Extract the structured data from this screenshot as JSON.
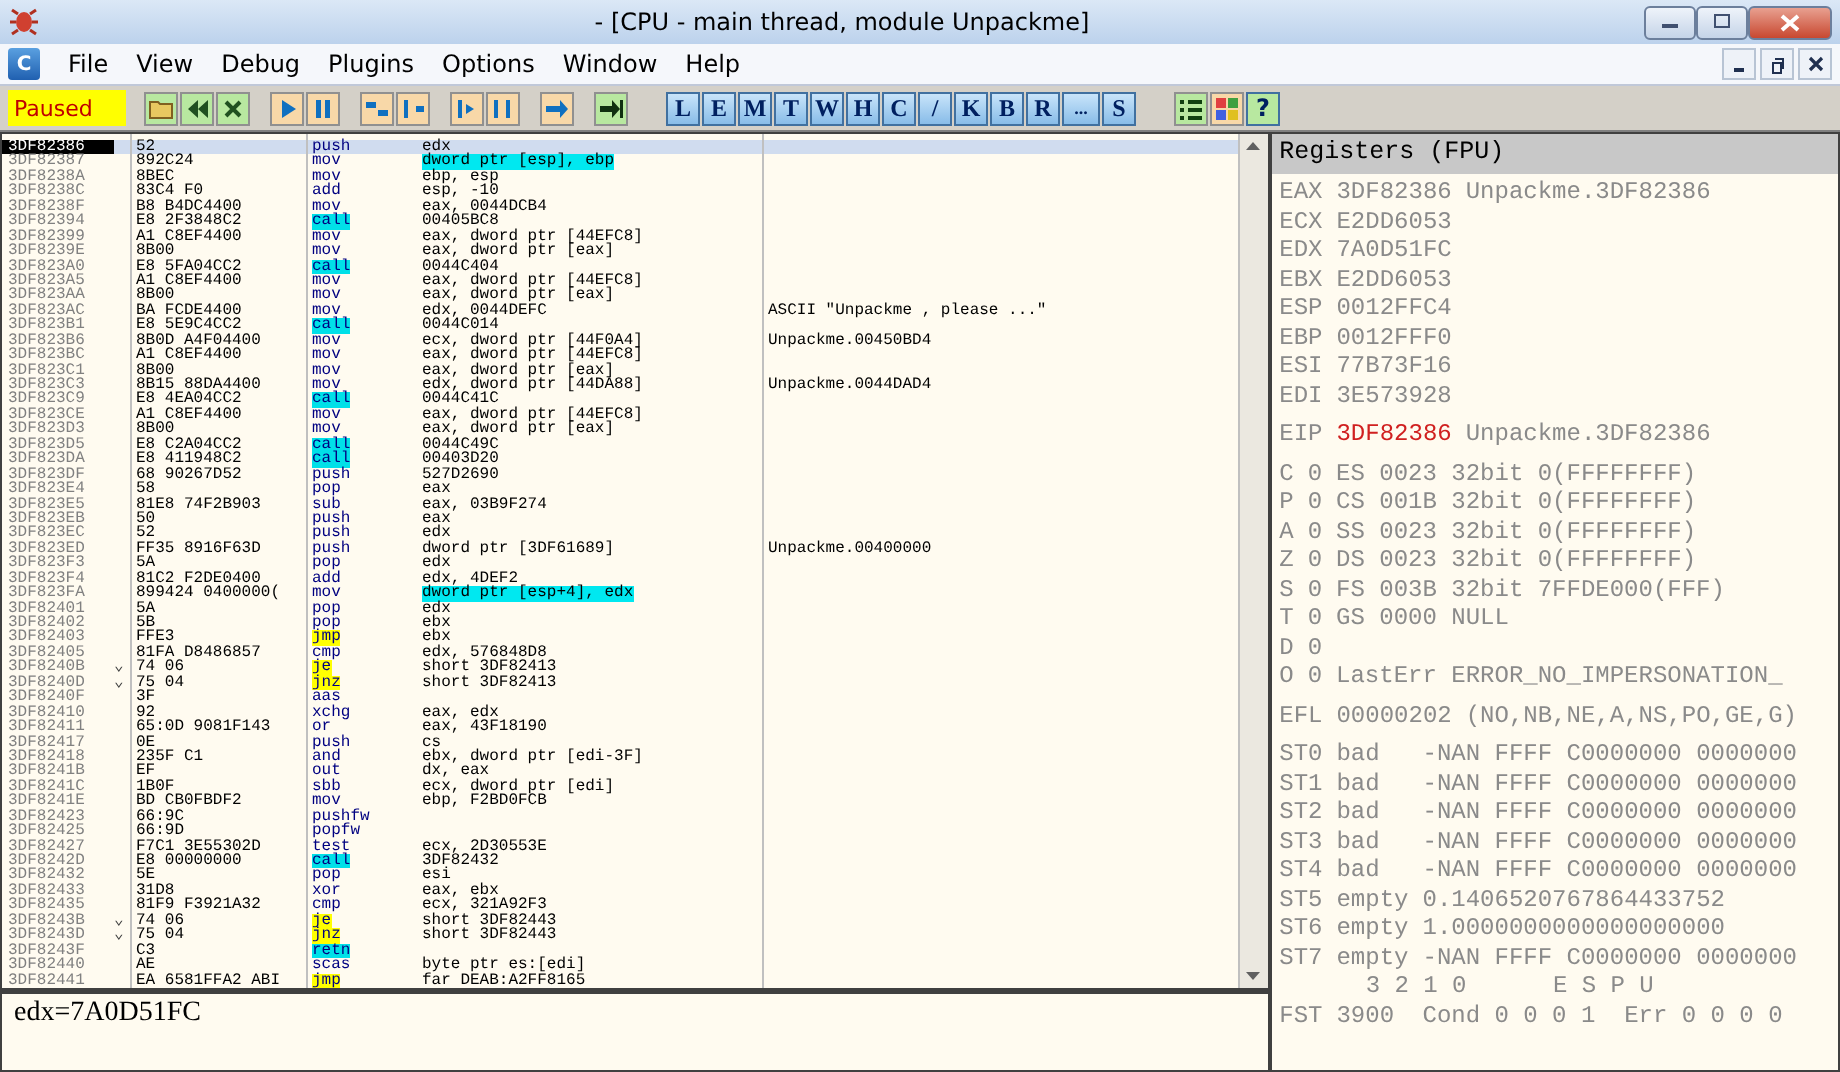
{
  "window": {
    "title": "- [CPU - main thread, module Unpackme]"
  },
  "menu": {
    "child_icon": "C",
    "items": [
      "File",
      "View",
      "Debug",
      "Plugins",
      "Options",
      "Window",
      "Help"
    ]
  },
  "toolbar": {
    "status": "Paused",
    "view_buttons": [
      "L",
      "E",
      "M",
      "T",
      "W",
      "H",
      "C",
      "/",
      "K",
      "B",
      "R",
      "...",
      "S"
    ],
    "help_button": "?"
  },
  "disassembly": {
    "rows": [
      {
        "address": "3DF82386",
        "hex": "52",
        "mnemonic": "push",
        "operand": "edx",
        "kind": "plain",
        "selected": true,
        "operand_marked": false
      },
      {
        "address": "3DF82387",
        "hex": "892C24",
        "mnemonic": "mov",
        "operand": "dword ptr [esp], ebp",
        "kind": "plain",
        "selected": false,
        "operand_marked": true
      },
      {
        "address": "3DF8238A",
        "hex": "8BEC",
        "mnemonic": "mov",
        "operand": "ebp, esp",
        "kind": "plain",
        "selected": false,
        "operand_marked": false
      },
      {
        "address": "3DF8238C",
        "hex": "83C4 F0",
        "mnemonic": "add",
        "operand": "esp, -10",
        "kind": "plain",
        "selected": false,
        "operand_marked": false
      },
      {
        "address": "3DF8238F",
        "hex": "B8 B4DC4400",
        "mnemonic": "mov",
        "operand": "eax, 0044DCB4",
        "kind": "plain",
        "selected": false,
        "operand_marked": false
      },
      {
        "address": "3DF82394",
        "hex": "E8 2F3848C2",
        "mnemonic": "call",
        "operand": "00405BC8",
        "kind": "call",
        "selected": false,
        "operand_marked": false
      },
      {
        "address": "3DF82399",
        "hex": "A1 C8EF4400",
        "mnemonic": "mov",
        "operand": "eax, dword ptr [44EFC8]",
        "kind": "plain",
        "selected": false,
        "operand_marked": false
      },
      {
        "address": "3DF8239E",
        "hex": "8B00",
        "mnemonic": "mov",
        "operand": "eax, dword ptr [eax]",
        "kind": "plain",
        "selected": false,
        "operand_marked": false
      },
      {
        "address": "3DF823A0",
        "hex": "E8 5FA04CC2",
        "mnemonic": "call",
        "operand": "0044C404",
        "kind": "call",
        "selected": false,
        "operand_marked": false
      },
      {
        "address": "3DF823A5",
        "hex": "A1 C8EF4400",
        "mnemonic": "mov",
        "operand": "eax, dword ptr [44EFC8]",
        "kind": "plain",
        "selected": false,
        "operand_marked": false
      },
      {
        "address": "3DF823AA",
        "hex": "8B00",
        "mnemonic": "mov",
        "operand": "eax, dword ptr [eax]",
        "kind": "plain",
        "selected": false,
        "operand_marked": false
      },
      {
        "address": "3DF823AC",
        "hex": "BA FCDE4400",
        "mnemonic": "mov",
        "operand": "edx, 0044DEFC",
        "comment": "ASCII \"Unpackme , please ...\"",
        "kind": "plain",
        "selected": false,
        "operand_marked": false
      },
      {
        "address": "3DF823B1",
        "hex": "E8 5E9C4CC2",
        "mnemonic": "call",
        "operand": "0044C014",
        "kind": "call",
        "selected": false,
        "operand_marked": false
      },
      {
        "address": "3DF823B6",
        "hex": "8B0D A4F04400",
        "mnemonic": "mov",
        "operand": "ecx, dword ptr [44F0A4]",
        "comment": "Unpackme.00450BD4",
        "kind": "plain",
        "selected": false,
        "operand_marked": false
      },
      {
        "address": "3DF823BC",
        "hex": "A1 C8EF4400",
        "mnemonic": "mov",
        "operand": "eax, dword ptr [44EFC8]",
        "kind": "plain",
        "selected": false,
        "operand_marked": false
      },
      {
        "address": "3DF823C1",
        "hex": "8B00",
        "mnemonic": "mov",
        "operand": "eax, dword ptr [eax]",
        "kind": "plain",
        "selected": false,
        "operand_marked": false
      },
      {
        "address": "3DF823C3",
        "hex": "8B15 88DA4400",
        "mnemonic": "mov",
        "operand": "edx, dword ptr [44DA88]",
        "comment": "Unpackme.0044DAD4",
        "kind": "plain",
        "selected": false,
        "operand_marked": false
      },
      {
        "address": "3DF823C9",
        "hex": "E8 4EA04CC2",
        "mnemonic": "call",
        "operand": "0044C41C",
        "kind": "call",
        "selected": false,
        "operand_marked": false
      },
      {
        "address": "3DF823CE",
        "hex": "A1 C8EF4400",
        "mnemonic": "mov",
        "operand": "eax, dword ptr [44EFC8]",
        "kind": "plain",
        "selected": false,
        "operand_marked": false
      },
      {
        "address": "3DF823D3",
        "hex": "8B00",
        "mnemonic": "mov",
        "operand": "eax, dword ptr [eax]",
        "kind": "plain",
        "selected": false,
        "operand_marked": false
      },
      {
        "address": "3DF823D5",
        "hex": "E8 C2A04CC2",
        "mnemonic": "call",
        "operand": "0044C49C",
        "kind": "call",
        "selected": false,
        "operand_marked": false
      },
      {
        "address": "3DF823DA",
        "hex": "E8 411948C2",
        "mnemonic": "call",
        "operand": "00403D20",
        "kind": "call",
        "selected": false,
        "operand_marked": false
      },
      {
        "address": "3DF823DF",
        "hex": "68 90267D52",
        "mnemonic": "push",
        "operand": "527D2690",
        "kind": "plain",
        "selected": false,
        "operand_marked": false
      },
      {
        "address": "3DF823E4",
        "hex": "58",
        "mnemonic": "pop",
        "operand": "eax",
        "kind": "plain",
        "selected": false,
        "operand_marked": false
      },
      {
        "address": "3DF823E5",
        "hex": "81E8 74F2B903",
        "mnemonic": "sub",
        "operand": "eax, 03B9F274",
        "kind": "plain",
        "selected": false,
        "operand_marked": false
      },
      {
        "address": "3DF823EB",
        "hex": "50",
        "mnemonic": "push",
        "operand": "eax",
        "kind": "plain",
        "selected": false,
        "operand_marked": false
      },
      {
        "address": "3DF823EC",
        "hex": "52",
        "mnemonic": "push",
        "operand": "edx",
        "kind": "plain",
        "selected": false,
        "operand_marked": false
      },
      {
        "address": "3DF823ED",
        "hex": "FF35 8916F63D",
        "mnemonic": "push",
        "operand": "dword ptr [3DF61689]",
        "comment": "Unpackme.00400000",
        "kind": "plain",
        "selected": false,
        "operand_marked": false
      },
      {
        "address": "3DF823F3",
        "hex": "5A",
        "mnemonic": "pop",
        "operand": "edx",
        "kind": "plain",
        "selected": false,
        "operand_marked": false
      },
      {
        "address": "3DF823F4",
        "hex": "81C2 F2DE0400",
        "mnemonic": "add",
        "operand": "edx, 4DEF2",
        "kind": "plain",
        "selected": false,
        "operand_marked": false
      },
      {
        "address": "3DF823FA",
        "hex": "899424 0400000(",
        "mnemonic": "mov",
        "operand": "dword ptr [esp+4], edx",
        "kind": "plain",
        "selected": false,
        "operand_marked": true
      },
      {
        "address": "3DF82401",
        "hex": "5A",
        "mnemonic": "pop",
        "operand": "edx",
        "kind": "plain",
        "selected": false,
        "operand_marked": false
      },
      {
        "address": "3DF82402",
        "hex": "5B",
        "mnemonic": "pop",
        "operand": "ebx",
        "kind": "plain",
        "selected": false,
        "operand_marked": false
      },
      {
        "address": "3DF82403",
        "hex": "FFE3",
        "mnemonic": "jmp",
        "operand": "ebx",
        "kind": "jump",
        "selected": false,
        "operand_marked": false
      },
      {
        "address": "3DF82405",
        "hex": "81FA D8486857",
        "mnemonic": "cmp",
        "operand": "edx, 576848D8",
        "kind": "plain",
        "selected": false,
        "operand_marked": false
      },
      {
        "address": "3DF8240B",
        "jump_mark": "⌄",
        "hex": "74 06",
        "mnemonic": "je",
        "operand": "short 3DF82413",
        "kind": "jump",
        "selected": false,
        "operand_marked": false
      },
      {
        "address": "3DF8240D",
        "jump_mark": "⌄",
        "hex": "75 04",
        "mnemonic": "jnz",
        "operand": "short 3DF82413",
        "kind": "jump",
        "selected": false,
        "operand_marked": false
      },
      {
        "address": "3DF8240F",
        "hex": "3F",
        "mnemonic": "aas",
        "kind": "plain",
        "selected": false,
        "operand_marked": false
      },
      {
        "address": "3DF82410",
        "hex": "92",
        "mnemonic": "xchg",
        "operand": "eax, edx",
        "kind": "plain",
        "selected": false,
        "operand_marked": false
      },
      {
        "address": "3DF82411",
        "hex": "65:0D 9081F143",
        "mnemonic": "or",
        "operand": "eax, 43F18190",
        "kind": "plain",
        "selected": false,
        "operand_marked": false
      },
      {
        "address": "3DF82417",
        "hex": "0E",
        "mnemonic": "push",
        "operand": "cs",
        "kind": "plain",
        "selected": false,
        "operand_marked": false
      },
      {
        "address": "3DF82418",
        "hex": "235F C1",
        "mnemonic": "and",
        "operand": "ebx, dword ptr [edi-3F]",
        "kind": "plain",
        "selected": false,
        "operand_marked": false
      },
      {
        "address": "3DF8241B",
        "hex": "EF",
        "mnemonic": "out",
        "operand": "dx, eax",
        "kind": "plain",
        "selected": false,
        "operand_marked": false
      },
      {
        "address": "3DF8241C",
        "hex": "1B0F",
        "mnemonic": "sbb",
        "operand": "ecx, dword ptr [edi]",
        "kind": "plain",
        "selected": false,
        "operand_marked": false
      },
      {
        "address": "3DF8241E",
        "hex": "BD CB0FBDF2",
        "mnemonic": "mov",
        "operand": "ebp, F2BD0FCB",
        "kind": "plain",
        "selected": false,
        "operand_marked": false
      },
      {
        "address": "3DF82423",
        "hex": "66:9C",
        "mnemonic": "pushfw",
        "kind": "plain",
        "selected": false,
        "operand_marked": false
      },
      {
        "address": "3DF82425",
        "hex": "66:9D",
        "mnemonic": "popfw",
        "kind": "plain",
        "selected": false,
        "operand_marked": false
      },
      {
        "address": "3DF82427",
        "hex": "F7C1 3E55302D",
        "mnemonic": "test",
        "operand": "ecx, 2D30553E",
        "kind": "plain",
        "selected": false,
        "operand_marked": false
      },
      {
        "address": "3DF8242D",
        "hex": "E8 00000000",
        "mnemonic": "call",
        "operand": "3DF82432",
        "kind": "call",
        "selected": false,
        "operand_marked": false
      },
      {
        "address": "3DF82432",
        "hex": "5E",
        "mnemonic": "pop",
        "operand": "esi",
        "kind": "plain",
        "selected": false,
        "operand_marked": false
      },
      {
        "address": "3DF82433",
        "hex": "31D8",
        "mnemonic": "xor",
        "operand": "eax, ebx",
        "kind": "plain",
        "selected": false,
        "operand_marked": false
      },
      {
        "address": "3DF82435",
        "hex": "81F9 F3921A32",
        "mnemonic": "cmp",
        "operand": "ecx, 321A92F3",
        "kind": "plain",
        "selected": false,
        "operand_marked": false
      },
      {
        "address": "3DF8243B",
        "jump_mark": "⌄",
        "hex": "74 06",
        "mnemonic": "je",
        "operand": "short 3DF82443",
        "kind": "jump",
        "selected": false,
        "operand_marked": false
      },
      {
        "address": "3DF8243D",
        "jump_mark": "⌄",
        "hex": "75 04",
        "mnemonic": "jnz",
        "operand": "short 3DF82443",
        "kind": "jump",
        "selected": false,
        "operand_marked": false
      },
      {
        "address": "3DF8243F",
        "hex": "C3",
        "mnemonic": "retn",
        "kind": "ret",
        "selected": false,
        "operand_marked": false
      },
      {
        "address": "3DF82440",
        "hex": "AE",
        "mnemonic": "scas",
        "operand": "byte ptr es:[edi]",
        "kind": "plain",
        "selected": false,
        "operand_marked": false
      },
      {
        "address": "3DF82441",
        "hex": "EA 6581FFA2 ABI",
        "mnemonic": "jmp",
        "operand": "far DEAB:A2FF8165",
        "kind": "jump",
        "selected": false,
        "operand_marked": false
      }
    ]
  },
  "info_pane": {
    "text": "edx=7A0D51FC"
  },
  "registers": {
    "title": "Registers (FPU)",
    "groups": [
      {
        "lines": [
          {
            "name": "EAX",
            "value": "3DF82386",
            "note": "Unpackme.3DF82386",
            "changed": false
          },
          {
            "name": "ECX",
            "value": "E2DD6053",
            "changed": false
          },
          {
            "name": "EDX",
            "value": "7A0D51FC",
            "changed": false
          },
          {
            "name": "EBX",
            "value": "E2DD6053",
            "changed": false
          },
          {
            "name": "ESP",
            "value": "0012FFC4",
            "changed": false
          },
          {
            "name": "EBP",
            "value": "0012FFF0",
            "changed": false
          },
          {
            "name": "ESI",
            "value": "77B73F16",
            "changed": false
          },
          {
            "name": "EDI",
            "value": "3E573928",
            "changed": false
          }
        ]
      },
      {
        "lines": [
          {
            "name": "EIP",
            "value": "3DF82386",
            "note": "Unpackme.3DF82386",
            "changed": true
          }
        ]
      },
      {
        "lines": [
          {
            "name": "C",
            "value": "0",
            "note": "ES 0023 32bit 0(FFFFFFFF)",
            "changed": false
          },
          {
            "name": "P",
            "value": "0",
            "note": "CS 001B 32bit 0(FFFFFFFF)",
            "changed": false
          },
          {
            "name": "A",
            "value": "0",
            "note": "SS 0023 32bit 0(FFFFFFFF)",
            "changed": false
          },
          {
            "name": "Z",
            "value": "0",
            "note": "DS 0023 32bit 0(FFFFFFFF)",
            "changed": false
          },
          {
            "name": "S",
            "value": "0",
            "note": "FS 003B 32bit 7FFDE000(FFF)",
            "changed": false
          },
          {
            "name": "T",
            "value": "0",
            "note": "GS 0000 NULL",
            "changed": false
          },
          {
            "name": "D",
            "value": "0",
            "changed": false
          },
          {
            "name": "O",
            "value": "0",
            "note": "LastErr ERROR_NO_IMPERSONATION_",
            "changed": false
          }
        ]
      },
      {
        "lines": [
          {
            "name": "EFL",
            "value": "00000202",
            "note": "(NO,NB,NE,A,NS,PO,GE,G)",
            "changed": false
          }
        ]
      },
      {
        "lines": [
          {
            "name": "ST0",
            "value": "bad",
            "note": "-NAN FFFF C0000000 0000000",
            "changed": false
          },
          {
            "name": "ST1",
            "value": "bad",
            "note": "-NAN FFFF C0000000 0000000",
            "changed": false
          },
          {
            "name": "ST2",
            "value": "bad",
            "note": "-NAN FFFF C0000000 0000000",
            "changed": false
          },
          {
            "name": "ST3",
            "value": "bad",
            "note": "-NAN FFFF C0000000 0000000",
            "changed": false
          },
          {
            "name": "ST4",
            "value": "bad",
            "note": "-NAN FFFF C0000000 0000000",
            "changed": false
          },
          {
            "name": "ST5",
            "value": "empty",
            "note": "0.1406520767864433752",
            "changed": false
          },
          {
            "name": "ST6",
            "value": "empty",
            "note": "1.0000000000000000000",
            "changed": false
          },
          {
            "name": "ST7",
            "value": "empty",
            "note": "-NAN FFFF C0000000 0000000",
            "changed": false
          },
          {
            "note": "      3 2 1 0      E S P U",
            "changed": false
          },
          {
            "name": "FST",
            "value": "3900",
            "note": "Cond 0 0 0 1  Err 0 0 0 0",
            "changed": false
          }
        ]
      }
    ]
  }
}
